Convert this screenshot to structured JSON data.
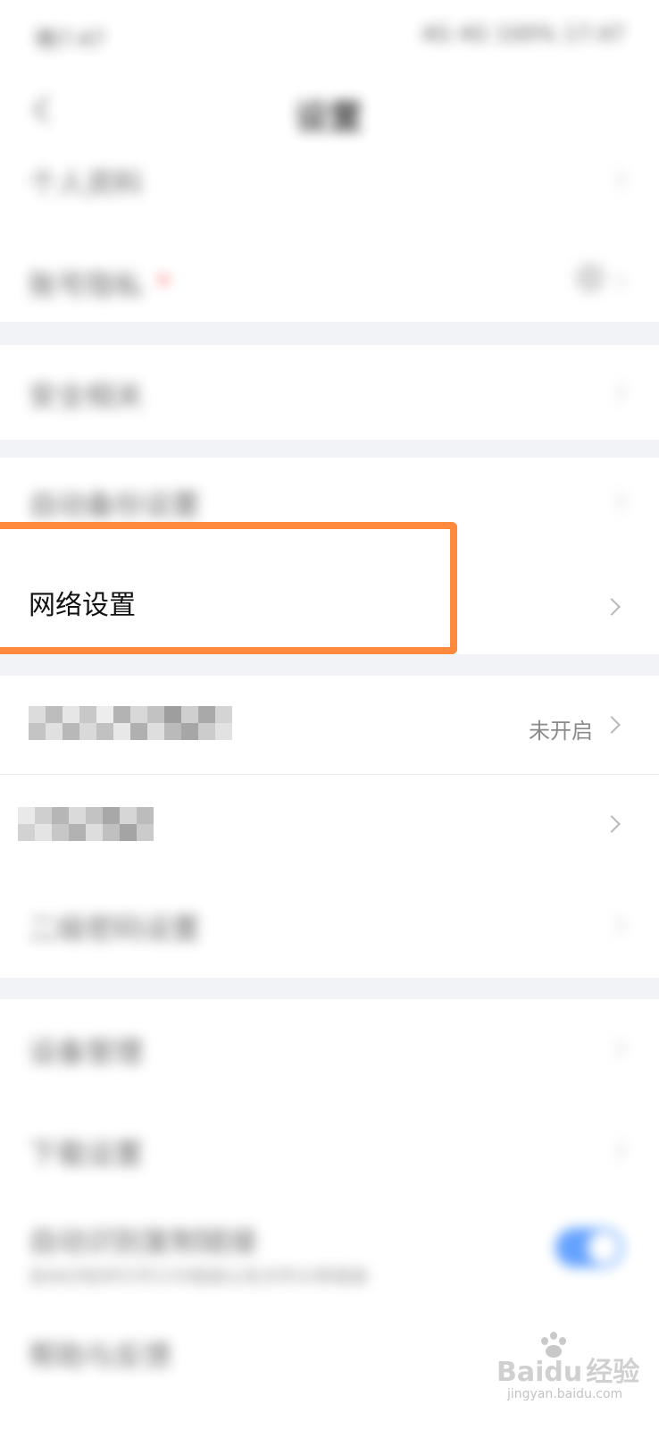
{
  "status_bar": {
    "left": "晚7:47",
    "right": "4G 4G 100% 17:47"
  },
  "header": {
    "title": "设置",
    "back_icon": "back-arrow-icon"
  },
  "sections": {
    "s1": [
      "个人资料",
      "账号隐私"
    ],
    "s2": [
      "安全相关"
    ],
    "s3": [
      "自动备份设置",
      "网络设置"
    ],
    "s4_items": [
      {
        "label": "百度网盘卡",
        "value": "未开启"
      },
      {
        "label": "隐私"
      }
    ],
    "s4_extra": "二级密码设置",
    "s5": [
      "设备管理",
      "下载设置"
    ],
    "auto_row": {
      "title": "自动识别复制链接",
      "subtitle": "自动识别并打开口令链接以及文件分享链接",
      "toggle_on": true
    },
    "last": "帮助与反馈"
  },
  "highlight": {
    "color": "#ff8a3d",
    "target": "网络设置"
  },
  "watermark": {
    "brand": "Bai",
    "du": "du",
    "cn": "经验",
    "url": "jingyan.baidu.com"
  },
  "colors": {
    "toggle": "#3d8bff",
    "gap": "#f2f3f7",
    "red_dot": "#ff4d4f"
  }
}
